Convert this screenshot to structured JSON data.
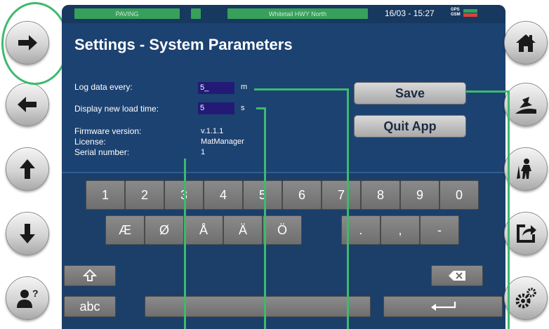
{
  "status": {
    "mode": "PAVING",
    "project": "Whitetail HWY North",
    "datetime": "16/03 - 15:27",
    "gps_label": "GPS",
    "gsm_label": "GSM",
    "gps_color": "#37a05a",
    "gsm_color": "#d94141"
  },
  "page": {
    "title": "Settings  - System Parameters"
  },
  "settings": {
    "log_label": "Log data every:",
    "log_value": "5_",
    "log_unit": "m",
    "load_label": "Display new load time:",
    "load_value": "5",
    "load_unit": "s",
    "firmware_label": "Firmware version:",
    "firmware_value": "v.1.1.1",
    "license_label": "License:",
    "license_value": "MatManager",
    "serial_label": "Serial number:",
    "serial_value": "1"
  },
  "actions": {
    "save": "Save",
    "quit": "Quit App"
  },
  "keyboard": {
    "digits": [
      "1",
      "2",
      "3",
      "4",
      "5",
      "6",
      "7",
      "8",
      "9",
      "0"
    ],
    "letters": [
      "Æ",
      "Ø",
      "Å",
      "Ä",
      "Ö"
    ],
    "punct": [
      ".",
      ",",
      "-"
    ],
    "abc_label": "abc",
    "shift_icon": "shift-arrow-icon",
    "backspace_icon": "backspace-icon",
    "enter_icon": "enter-icon"
  },
  "sidebar_left": [
    "arrow-right-icon",
    "arrow-left-icon",
    "arrow-up-icon",
    "arrow-down-icon",
    "user-help-icon"
  ],
  "sidebar_right": [
    "home-icon",
    "paver-icon",
    "worker-icon",
    "export-icon",
    "settings-gears-icon"
  ],
  "colors": {
    "panel": "#1c4271",
    "accent_green": "#3cba6e",
    "status_green": "#37a05a",
    "input_bg": "#231a78"
  }
}
